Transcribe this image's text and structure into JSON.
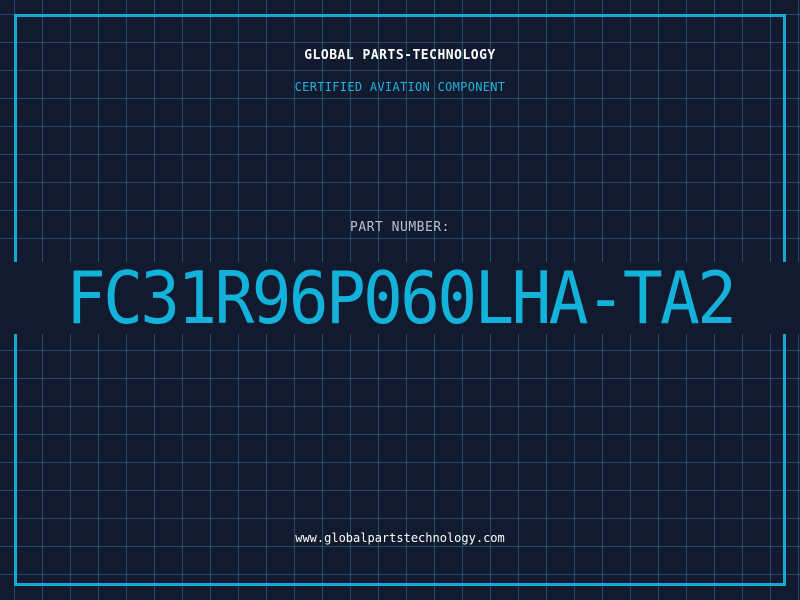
{
  "header": {
    "brand": "GLOBAL PARTS-TECHNOLOGY",
    "tagline": "CERTIFIED AVIATION COMPONENT"
  },
  "part": {
    "label": "PART NUMBER:",
    "number": "FC31R96P060LHA-TA2"
  },
  "footer": {
    "website": "www.globalpartstechnology.com"
  },
  "colors": {
    "background": "#111a2e",
    "accent": "#17a9d4",
    "grid": "#287896",
    "text_primary": "#ffffff",
    "text_muted": "#b6c3d4"
  }
}
